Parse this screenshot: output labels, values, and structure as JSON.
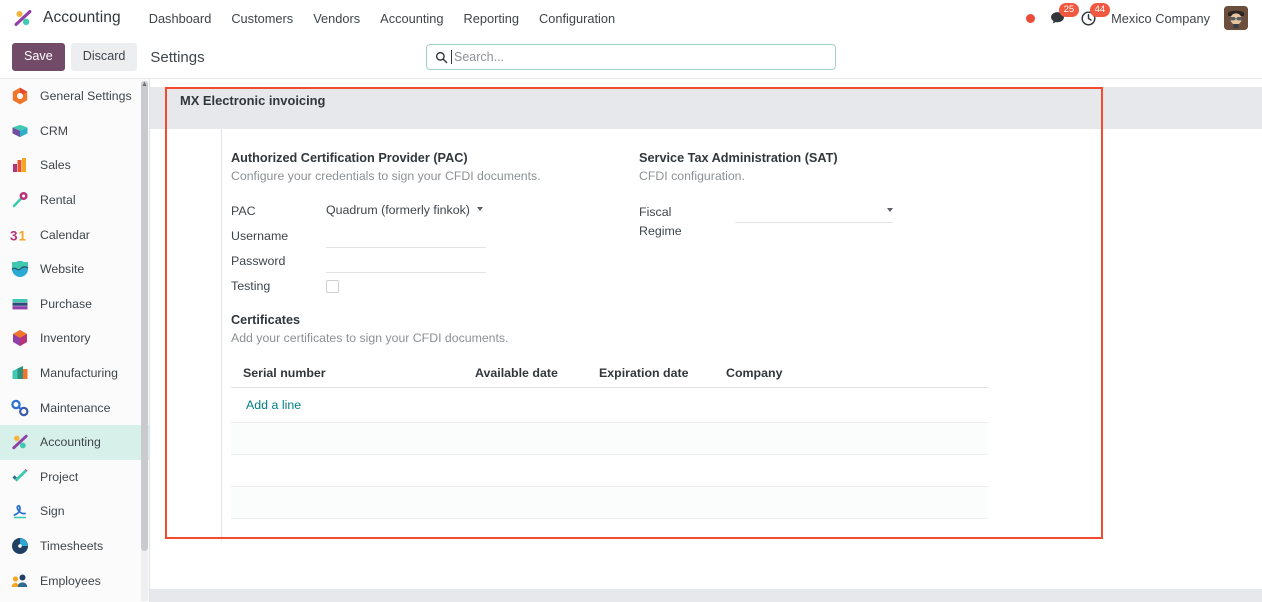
{
  "navbar": {
    "brand": "Accounting",
    "brand_icon": "accounting-app-icon",
    "menu": [
      {
        "label": "Dashboard"
      },
      {
        "label": "Customers"
      },
      {
        "label": "Vendors"
      },
      {
        "label": "Accounting"
      },
      {
        "label": "Reporting"
      },
      {
        "label": "Configuration"
      }
    ],
    "systray": {
      "status_dot": "red-status-dot",
      "messages_icon": "chat-bubble-icon",
      "messages_count": "25",
      "activities_icon": "clock-icon",
      "activities_count": "44",
      "company": "Mexico Company",
      "avatar": "user-avatar"
    }
  },
  "control_panel": {
    "save_label": "Save",
    "discard_label": "Discard",
    "title": "Settings",
    "search": {
      "icon": "search-icon",
      "placeholder": "Search...",
      "value": ""
    }
  },
  "sidebar": {
    "items": [
      {
        "label": "General Settings",
        "icon": "general-settings-icon",
        "active": false
      },
      {
        "label": "CRM",
        "icon": "crm-icon",
        "active": false
      },
      {
        "label": "Sales",
        "icon": "sales-icon",
        "active": false
      },
      {
        "label": "Rental",
        "icon": "rental-icon",
        "active": false
      },
      {
        "label": "Calendar",
        "icon": "calendar-icon",
        "active": false
      },
      {
        "label": "Website",
        "icon": "website-icon",
        "active": false
      },
      {
        "label": "Purchase",
        "icon": "purchase-icon",
        "active": false
      },
      {
        "label": "Inventory",
        "icon": "inventory-icon",
        "active": false
      },
      {
        "label": "Manufacturing",
        "icon": "manufacturing-icon",
        "active": false
      },
      {
        "label": "Maintenance",
        "icon": "maintenance-icon",
        "active": false
      },
      {
        "label": "Accounting",
        "icon": "accounting-icon",
        "active": true
      },
      {
        "label": "Project",
        "icon": "project-icon",
        "active": false
      },
      {
        "label": "Sign",
        "icon": "sign-icon",
        "active": false
      },
      {
        "label": "Timesheets",
        "icon": "timesheets-icon",
        "active": false
      },
      {
        "label": "Employees",
        "icon": "employees-icon",
        "active": false
      }
    ]
  },
  "main": {
    "section_title": "MX Electronic invoicing",
    "pac": {
      "title": "Authorized Certification Provider (PAC)",
      "subtitle": "Configure your credentials to sign your CFDI documents.",
      "fields": {
        "pac_label": "PAC",
        "pac_value": "Quadrum (formerly finkok)",
        "username_label": "Username",
        "username_value": "",
        "password_label": "Password",
        "password_value": "",
        "testing_label": "Testing",
        "testing_checked": false
      }
    },
    "sat": {
      "title": "Service Tax Administration (SAT)",
      "subtitle": "CFDI configuration.",
      "fields": {
        "fiscal_regime_label_line1": "Fiscal",
        "fiscal_regime_label_line2": "Regime",
        "fiscal_regime_value": ""
      }
    },
    "certificates": {
      "title": "Certificates",
      "subtitle": "Add your certificates to sign your CFDI documents.",
      "columns": [
        {
          "label": "Serial number"
        },
        {
          "label": "Available date"
        },
        {
          "label": "Expiration date"
        },
        {
          "label": "Company"
        }
      ],
      "add_line_label": "Add a line",
      "rows": []
    }
  },
  "annotation": {
    "highlight_color": "#f24b30"
  }
}
